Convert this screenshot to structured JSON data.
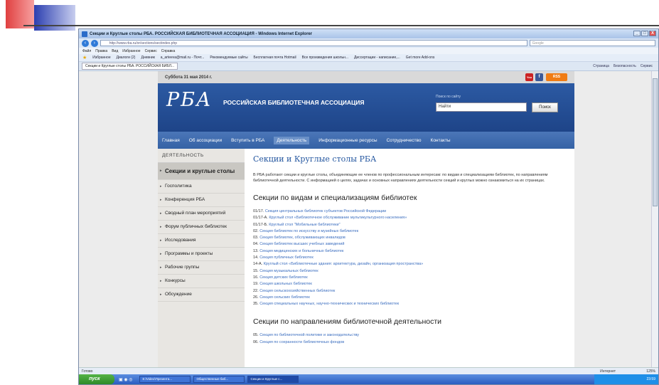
{
  "window": {
    "title": "Секции и Круглые столы РБА. РОССИЙСКАЯ БИБЛИОТЕЧНАЯ АССОЦИАЦИЯ - Windows Internet Explorer",
    "buttons": [
      "_",
      "□",
      "X"
    ]
  },
  "browser": {
    "address": "http://www.rba.ru/or/sections/sectindex.php",
    "search_placeholder": "Google",
    "menu": [
      "Файл",
      "Правка",
      "Вид",
      "Избранное",
      "Сервис",
      "Справка"
    ],
    "favorites": [
      "Избранное",
      "Диалоги (2)",
      "Дневник",
      "a_arteeva@mail.ru - Почт...",
      "Рекомендуемые сайты",
      "Бесплатная почта Hotmail",
      "Все произведения школьн...",
      "Диссертации - написание,...",
      "Get more Add-ons"
    ],
    "tab": "Секции и Круглые столы РБА. РОССИЙСКАЯ БИБЛ...",
    "commands": [
      "Страница",
      "Безопасность",
      "Сервис"
    ],
    "status_left": "Готово",
    "status_zone": "Интернет",
    "zoom": "125%"
  },
  "site": {
    "date": "Суббота 31 мая 2014 г.",
    "rss": "RSS",
    "logo": "РБА",
    "org_name": "РОССИЙСКАЯ БИБЛИОТЕЧНАЯ АССОЦИАЦИЯ",
    "search_label": "Поиск по сайту",
    "search_value": "Найти",
    "search_button": "Поиск",
    "nav": [
      "Главная",
      "Об ассоциации",
      "Вступить в РБА",
      "Деятельность",
      "Информационные ресурсы",
      "Сотрудничество",
      "Контакты"
    ],
    "sidebar_title": "ДЕЯТЕЛЬНОСТЬ",
    "sidebar": [
      "Секции и круглые столы",
      "Госполитика",
      "Конференция РБА",
      "Сводный план мероприятий",
      "Форум публичных библиотек",
      "Исследования",
      "Программы и проекты",
      "Рабочие группы",
      "Конкурсы",
      "Обсуждение"
    ],
    "page_title": "Секции и Круглые столы РБА",
    "intro": "В РБА работают секции и круглые столы, объединяющие ее членов по профессиональным интересам: по видам и специализациям библиотек, по направлениям библиотечной деятельности. С информацией о целях, задачах и основных направлениях деятельности секций и круглых можно ознакомиться на их страницах.",
    "section1_title": "Секции по видам и специализациям библиотек",
    "section1_items": [
      {
        "code": "01/17.",
        "text": "Секция центральных библиотек субъектов Российской Федерации"
      },
      {
        "code": "01/17-А.",
        "text": "Круглый стол «Библиотечное обслуживание мультикультурного населения»"
      },
      {
        "code": "01/17-Б.",
        "text": "Круглый стол \"Мобильные библиотеки\""
      },
      {
        "code": "02.",
        "text": "Секция библиотек по искусству и музейных библиотек"
      },
      {
        "code": "03.",
        "text": "Секция библиотек, обслуживающих инвалидов"
      },
      {
        "code": "04.",
        "text": "Секция библиотек высших учебных заведений"
      },
      {
        "code": "13.",
        "text": "Секция медицинских и больничных библиотек"
      },
      {
        "code": "14.",
        "text": "Секция публичных библиотек"
      },
      {
        "code": "14-А.",
        "text": "Круглый стол «Библиотечные здания: архитектура, дизайн, организация пространства»"
      },
      {
        "code": "15.",
        "text": "Секция музыкальных библиотек"
      },
      {
        "code": "16.",
        "text": "Секция детских библиотек"
      },
      {
        "code": "19.",
        "text": "Секция школьных библиотек"
      },
      {
        "code": "22.",
        "text": "Секция сельскохозяйственных библиотек"
      },
      {
        "code": "26.",
        "text": "Секция сельских библиотек"
      },
      {
        "code": "35.",
        "text": "Секция специальных научных, научно-технических и технических библиотек"
      }
    ],
    "section2_title": "Секции по направлениям библиотечной деятельности",
    "section2_items": [
      {
        "code": "05.",
        "text": "Секция по библиотечной политике и законодательству"
      },
      {
        "code": "06.",
        "text": "Секция по сохранности библиотечных фондов"
      }
    ]
  },
  "taskbar": {
    "start": "пуск",
    "tasks": [
      "E:\\Video\\Презента...",
      "Общественные биб...",
      "Секции и Круглые с..."
    ],
    "clock": "23:59"
  }
}
